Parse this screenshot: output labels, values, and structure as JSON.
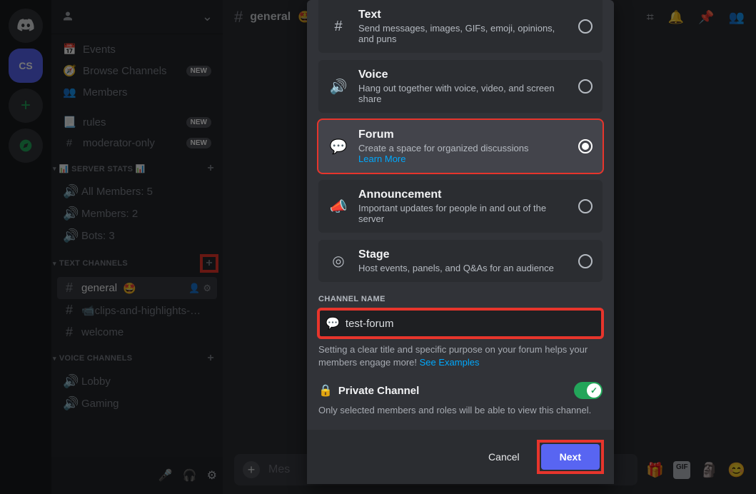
{
  "guild_initials": "CS",
  "sidebar": {
    "events": "Events",
    "browse": "Browse Channels",
    "members_link": "Members",
    "new_badge": "NEW",
    "rules": "rules",
    "moderator": "moderator-only",
    "cat_stats_pre": "📊 SERVER STATS 📊",
    "stat_all": "All Members: 5",
    "stat_members": "Members: 2",
    "stat_bots": "Bots: 3",
    "cat_text": "TEXT CHANNELS",
    "ch_general": "general",
    "ch_general_emoji": "🤩",
    "ch_clips": "📹clips-and-highlights-…",
    "ch_welcome": "welcome",
    "cat_voice": "VOICE CHANNELS",
    "vc_lobby": "Lobby",
    "vc_gaming": "Gaming"
  },
  "topbar": {
    "channel": "general",
    "emoji": "🤩"
  },
  "chat": {
    "placeholder": "Mes"
  },
  "modal": {
    "types": {
      "text": {
        "title": "Text",
        "desc": "Send messages, images, GIFs, emoji, opinions, and puns"
      },
      "voice": {
        "title": "Voice",
        "desc": "Hang out together with voice, video, and screen share"
      },
      "forum": {
        "title": "Forum",
        "desc": "Create a space for organized discussions",
        "learn": "Learn More"
      },
      "announce": {
        "title": "Announcement",
        "desc": "Important updates for people in and out of the server"
      },
      "stage": {
        "title": "Stage",
        "desc": "Host events, panels, and Q&As for an audience"
      }
    },
    "name_label": "CHANNEL NAME",
    "name_value": "test-forum",
    "helper_pre": "Setting a clear title and specific purpose on your forum helps your members engage more! ",
    "helper_link": "See Examples",
    "private_title": "Private Channel",
    "private_desc": "Only selected members and roles will be able to view this channel.",
    "cancel": "Cancel",
    "next": "Next"
  }
}
